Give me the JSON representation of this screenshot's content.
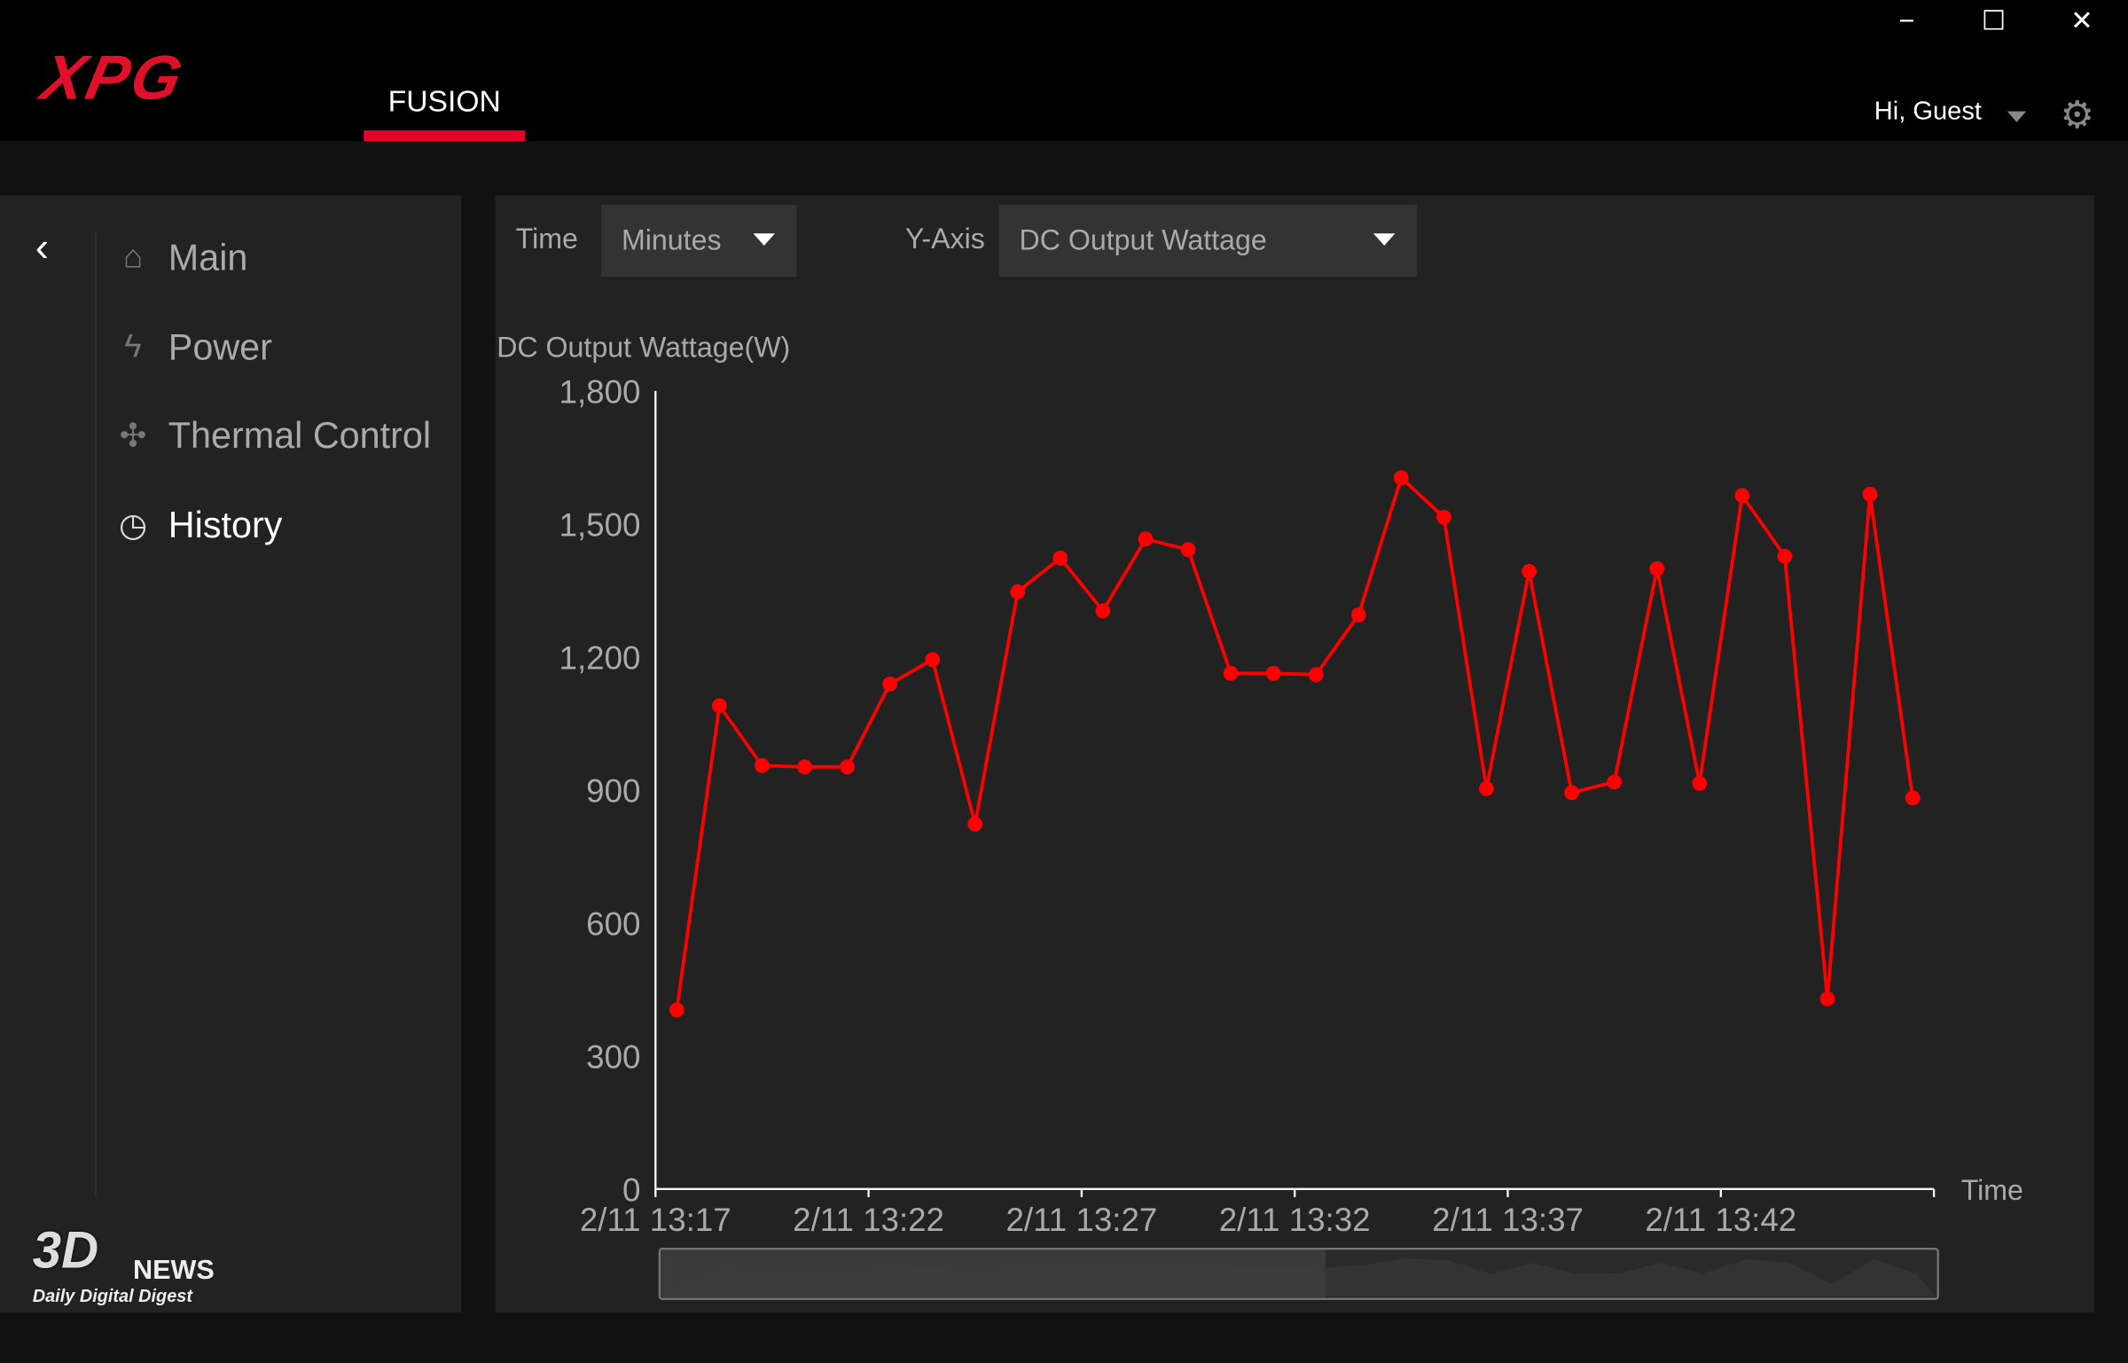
{
  "app": {
    "logo": "XPG",
    "tab": "FUSION"
  },
  "window_controls": {
    "minimize": "−",
    "maximize": "☐",
    "close": "✕"
  },
  "user": {
    "greeting": "Hi, Guest"
  },
  "sidebar": {
    "back_icon": "chevron-left",
    "items": [
      {
        "label": "Main",
        "icon": "home-icon",
        "glyph": "⌂",
        "active": false
      },
      {
        "label": "Power",
        "icon": "lightning-icon",
        "glyph": "ϟ",
        "active": false
      },
      {
        "label": "Thermal Control",
        "icon": "fan-icon",
        "glyph": "✣",
        "active": false
      },
      {
        "label": "History",
        "icon": "history-icon",
        "glyph": "◷",
        "active": true
      }
    ]
  },
  "toolbar": {
    "time_label": "Time",
    "time_value": "Minutes",
    "yaxis_label": "Y-Axis",
    "yaxis_value": "DC Output Wattage"
  },
  "colors": {
    "accent": "#e4002b",
    "series": "#ff0000"
  },
  "chart_data": {
    "type": "line",
    "ylabel": "DC Output Wattage(W)",
    "xlabel": "Time",
    "ylim": [
      0,
      1800
    ],
    "yticks": [
      "0",
      "300",
      "600",
      "900",
      "1,200",
      "1,500",
      "1,800"
    ],
    "xlim": [
      "13:17:00",
      "13:47:00"
    ],
    "xticks": [
      "2/11 13:17",
      "2/11 13:22",
      "2/11 13:27",
      "2/11 13:32",
      "2/11 13:37",
      "2/11 13:42"
    ],
    "x": [
      "13:17:30",
      "13:18:30",
      "13:19:30",
      "13:20:30",
      "13:21:30",
      "13:22:30",
      "13:23:30",
      "13:24:30",
      "13:25:30",
      "13:26:30",
      "13:27:30",
      "13:28:30",
      "13:29:30",
      "13:30:30",
      "13:31:30",
      "13:32:30",
      "13:33:30",
      "13:34:30",
      "13:35:30",
      "13:36:30",
      "13:37:30",
      "13:38:30",
      "13:39:30",
      "13:40:30",
      "13:41:30",
      "13:42:30",
      "13:43:30",
      "13:44:30",
      "13:45:30",
      "13:46:30"
    ],
    "values": [
      404,
      1090,
      955,
      952,
      952,
      1139,
      1194,
      823,
      1347,
      1423,
      1304,
      1466,
      1442,
      1163,
      1163,
      1160,
      1295,
      1604,
      1515,
      903,
      1393,
      894,
      918,
      1399,
      915,
      1564,
      1427,
      429,
      1567,
      882
    ],
    "grid": false,
    "scrollbar_window": [
      0,
      0.52
    ]
  },
  "watermark": {
    "brand": "3D",
    "brand2": "NEWS",
    "tagline": "Daily Digital Digest"
  }
}
